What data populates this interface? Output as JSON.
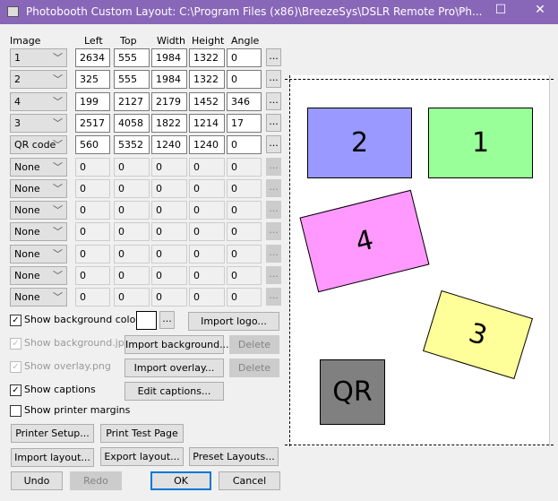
{
  "window": {
    "title": "Photobooth Custom Layout: C:\\Program Files (x86)\\BreezeSys\\DSLR Remote Pro\\Ph...",
    "minimize": "—",
    "maximize": "☐",
    "close": "✕"
  },
  "headers": {
    "image": "Image",
    "left": "Left",
    "top": "Top",
    "width": "Width",
    "height": "Height",
    "angle": "Angle"
  },
  "rows": [
    {
      "image": "1",
      "left": "2634",
      "top": "555",
      "width": "1984",
      "height": "1322",
      "angle": "0",
      "enabled": true
    },
    {
      "image": "2",
      "left": "325",
      "top": "555",
      "width": "1984",
      "height": "1322",
      "angle": "0",
      "enabled": true
    },
    {
      "image": "4",
      "left": "199",
      "top": "2127",
      "width": "2179",
      "height": "1452",
      "angle": "346",
      "enabled": true
    },
    {
      "image": "3",
      "left": "2517",
      "top": "4058",
      "width": "1822",
      "height": "1214",
      "angle": "17",
      "enabled": true
    },
    {
      "image": "QR code",
      "left": "560",
      "top": "5352",
      "width": "1240",
      "height": "1240",
      "angle": "0",
      "enabled": true
    },
    {
      "image": "None",
      "left": "0",
      "top": "0",
      "width": "0",
      "height": "0",
      "angle": "0",
      "enabled": false
    },
    {
      "image": "None",
      "left": "0",
      "top": "0",
      "width": "0",
      "height": "0",
      "angle": "0",
      "enabled": false
    },
    {
      "image": "None",
      "left": "0",
      "top": "0",
      "width": "0",
      "height": "0",
      "angle": "0",
      "enabled": false
    },
    {
      "image": "None",
      "left": "0",
      "top": "0",
      "width": "0",
      "height": "0",
      "angle": "0",
      "enabled": false
    },
    {
      "image": "None",
      "left": "0",
      "top": "0",
      "width": "0",
      "height": "0",
      "angle": "0",
      "enabled": false
    },
    {
      "image": "None",
      "left": "0",
      "top": "0",
      "width": "0",
      "height": "0",
      "angle": "0",
      "enabled": false
    },
    {
      "image": "None",
      "left": "0",
      "top": "0",
      "width": "0",
      "height": "0",
      "angle": "0",
      "enabled": false
    }
  ],
  "dots": "...",
  "options": {
    "show_bg_colour": "Show background colour",
    "bg_colour": "#ffffff",
    "show_bg_jpg": "Show background.jpg",
    "show_overlay": "Show overlay.png",
    "show_captions": "Show captions",
    "show_margins": "Show printer margins"
  },
  "buttons": {
    "import_logo": "Import logo...",
    "import_background": "Import background...",
    "delete": "Delete",
    "import_overlay": "Import overlay...",
    "edit_captions": "Edit captions...",
    "printer_setup": "Printer Setup...",
    "print_test": "Print Test Page",
    "import_layout": "Import layout...",
    "export_layout": "Export layout...",
    "preset_layouts": "Preset Layouts...",
    "undo": "Undo",
    "redo": "Redo",
    "ok": "OK",
    "cancel": "Cancel"
  },
  "preview": {
    "labels": [
      "2",
      "1",
      "4",
      "3",
      "QR"
    ],
    "colors": {
      "2": "#9999ff",
      "1": "#99ff99",
      "4": "#ff99ff",
      "3": "#ffff99",
      "QR": "#808080"
    }
  }
}
